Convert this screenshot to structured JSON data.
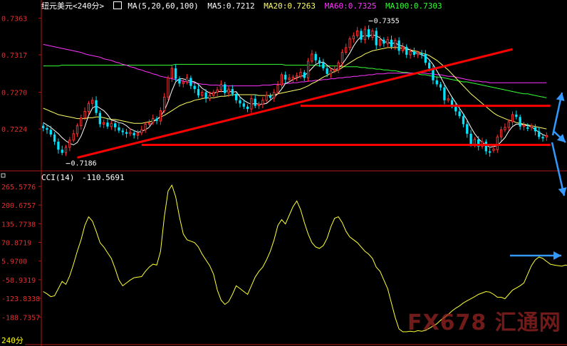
{
  "header": {
    "symbol": "纽元美元<240分>",
    "ma_params": "MA(5,20,60,100)",
    "ma5": "MA5:0.7212",
    "ma20": "MA20:0.7263",
    "ma60": "MA60:0.7325",
    "ma100": "MA100:0.7303"
  },
  "cci_header": {
    "label": "CCI(14)",
    "value": "-110.5691"
  },
  "period_tag": "240分",
  "watermark": "FX678 汇通网",
  "colors": {
    "up": "#ff3030",
    "down": "#00e5ff",
    "ma5": "#ffffff",
    "ma20": "#ffff66",
    "ma60": "#ff33ff",
    "ma100": "#33ff33",
    "cci": "#ffff33",
    "trend": "#ff0000",
    "arrow": "#3399ff",
    "axis": "#b01818"
  },
  "chart_data": [
    {
      "type": "candlestick",
      "ylim": [
        0.7175,
        0.7375
      ],
      "yticks": [
        "0.7363",
        "0.7317",
        "0.7270",
        "0.7224"
      ],
      "annotations": [
        {
          "text": "0.7355",
          "x": 86,
          "y": 0.7355
        },
        {
          "text": "0.7186",
          "x": 6,
          "y": 0.7186
        }
      ],
      "x_count": 134,
      "closes": [
        0.7225,
        0.7223,
        0.7217,
        0.7208,
        0.7198,
        0.7194,
        0.7201,
        0.721,
        0.7218,
        0.7228,
        0.7238,
        0.7246,
        0.7256,
        0.726,
        0.7244,
        0.723,
        0.7232,
        0.7227,
        0.7231,
        0.7226,
        0.7222,
        0.722,
        0.7218,
        0.7219,
        0.7216,
        0.7219,
        0.7223,
        0.723,
        0.7232,
        0.7237,
        0.7234,
        0.7247,
        0.7264,
        0.7288,
        0.73,
        0.7287,
        0.7281,
        0.7283,
        0.7288,
        0.7278,
        0.7274,
        0.7266,
        0.727,
        0.7262,
        0.7266,
        0.727,
        0.7273,
        0.728,
        0.7269,
        0.7274,
        0.7268,
        0.726,
        0.7256,
        0.7252,
        0.7249,
        0.7262,
        0.7253,
        0.7255,
        0.726,
        0.7266,
        0.7263,
        0.727,
        0.7279,
        0.7292,
        0.7286,
        0.7286,
        0.7289,
        0.729,
        0.7295,
        0.7288,
        0.7309,
        0.7318,
        0.731,
        0.7307,
        0.73,
        0.7293,
        0.7297,
        0.7298,
        0.7307,
        0.732,
        0.7326,
        0.7337,
        0.7341,
        0.7347,
        0.7336,
        0.7349,
        0.7339,
        0.7347,
        0.7329,
        0.7336,
        0.7331,
        0.7336,
        0.7327,
        0.7335,
        0.7322,
        0.7327,
        0.7317,
        0.7321,
        0.7317,
        0.7319,
        0.7318,
        0.7307,
        0.73,
        0.7285,
        0.728,
        0.7276,
        0.726,
        0.726,
        0.7254,
        0.7246,
        0.724,
        0.723,
        0.7218,
        0.7205,
        0.7211,
        0.7202,
        0.7208,
        0.7196,
        0.7197,
        0.7198,
        0.7214,
        0.7223,
        0.7226,
        0.7233,
        0.7242,
        0.7239,
        0.7227,
        0.7226,
        0.7226,
        0.7226,
        0.7221,
        0.7214,
        0.7214,
        0.7215
      ],
      "ma5": [
        0.7232,
        0.7229,
        0.7226,
        0.7222,
        0.7218,
        0.7213,
        0.7209,
        0.7206,
        0.7204,
        0.7207,
        0.7215,
        0.7227,
        0.7241,
        0.725,
        0.7253,
        0.725,
        0.7247,
        0.7242,
        0.7235,
        0.7234,
        0.7232,
        0.7231,
        0.7228,
        0.7224,
        0.7222,
        0.722,
        0.7221,
        0.7223,
        0.7226,
        0.7233,
        0.7236,
        0.724,
        0.7247,
        0.7258,
        0.7272,
        0.7283,
        0.7287,
        0.7287,
        0.7285,
        0.7284,
        0.7283,
        0.728,
        0.7275,
        0.7272,
        0.7269,
        0.7268,
        0.7271,
        0.7271,
        0.7271,
        0.7272,
        0.727,
        0.7271,
        0.7264,
        0.726,
        0.7257,
        0.7255,
        0.7256,
        0.7255,
        0.7255,
        0.7256,
        0.726,
        0.7264,
        0.7268,
        0.7274,
        0.7281,
        0.7283,
        0.7286,
        0.7288,
        0.729,
        0.7291,
        0.7295,
        0.73,
        0.7305,
        0.7307,
        0.7308,
        0.7304,
        0.73,
        0.7298,
        0.73,
        0.7305,
        0.7312,
        0.7319,
        0.7328,
        0.7335,
        0.734,
        0.7341,
        0.7341,
        0.7342,
        0.7341,
        0.7338,
        0.7333,
        0.7333,
        0.7331,
        0.7332,
        0.7329,
        0.7328,
        0.7325,
        0.7323,
        0.732,
        0.7319,
        0.7317,
        0.7315,
        0.7311,
        0.7305,
        0.7297,
        0.7289,
        0.728,
        0.7272,
        0.7264,
        0.7257,
        0.725,
        0.7243,
        0.7235,
        0.7226,
        0.7218,
        0.7212,
        0.7207,
        0.7204,
        0.7201,
        0.7202,
        0.7203,
        0.7208,
        0.7213,
        0.7221,
        0.7227,
        0.723,
        0.723,
        0.7229,
        0.7228,
        0.7227,
        0.7223,
        0.722,
        0.7217,
        0.7215
      ],
      "ma20": [
        0.725,
        0.7248,
        0.7246,
        0.7244,
        0.7242,
        0.7241,
        0.724,
        0.7239,
        0.7238,
        0.7237,
        0.7237,
        0.7237,
        0.7238,
        0.7238,
        0.7239,
        0.7239,
        0.7238,
        0.7237,
        0.7236,
        0.7236,
        0.7235,
        0.7234,
        0.7233,
        0.7232,
        0.7231,
        0.7231,
        0.7231,
        0.7232,
        0.7233,
        0.7234,
        0.7236,
        0.7239,
        0.7241,
        0.7244,
        0.7247,
        0.725,
        0.7253,
        0.7255,
        0.7257,
        0.7258,
        0.726,
        0.7261,
        0.7262,
        0.7263,
        0.7263,
        0.7263,
        0.7264,
        0.7265,
        0.7265,
        0.7266,
        0.7267,
        0.7267,
        0.7267,
        0.7267,
        0.7267,
        0.7267,
        0.7267,
        0.7266,
        0.7266,
        0.7266,
        0.7266,
        0.7267,
        0.7268,
        0.7269,
        0.727,
        0.7271,
        0.7272,
        0.7273,
        0.7274,
        0.7276,
        0.7278,
        0.7281,
        0.7283,
        0.7286,
        0.7289,
        0.7291,
        0.7294,
        0.7296,
        0.7298,
        0.7301,
        0.7304,
        0.7307,
        0.731,
        0.7313,
        0.7315,
        0.7318,
        0.732,
        0.7322,
        0.7323,
        0.7324,
        0.7325,
        0.7326,
        0.7326,
        0.7326,
        0.7326,
        0.7325,
        0.7324,
        0.7323,
        0.7322,
        0.7321,
        0.7319,
        0.7318,
        0.7316,
        0.7313,
        0.731,
        0.7306,
        0.7302,
        0.7298,
        0.7293,
        0.7288,
        0.7283,
        0.7278,
        0.7273,
        0.7268,
        0.7264,
        0.726,
        0.7256,
        0.7252,
        0.7248,
        0.7244,
        0.7241,
        0.7239,
        0.7237,
        0.7235,
        0.7234,
        0.7232,
        0.7231,
        0.723,
        0.7229,
        0.7228,
        0.7227,
        0.7226,
        0.7225,
        0.7224
      ],
      "ma60": [
        0.733,
        0.7329,
        0.7328,
        0.7327,
        0.7326,
        0.7325,
        0.7324,
        0.7323,
        0.7322,
        0.7321,
        0.732,
        0.7318,
        0.7317,
        0.7316,
        0.7315,
        0.7314,
        0.7312,
        0.7311,
        0.731,
        0.7308,
        0.7307,
        0.7305,
        0.7304,
        0.7302,
        0.7301,
        0.7299,
        0.7298,
        0.7296,
        0.7295,
        0.7293,
        0.7292,
        0.729,
        0.7289,
        0.7288,
        0.7287,
        0.7286,
        0.7285,
        0.7284,
        0.7283,
        0.7282,
        0.7282,
        0.7281,
        0.728,
        0.728,
        0.7279,
        0.7279,
        0.7279,
        0.7278,
        0.7278,
        0.7278,
        0.7278,
        0.7278,
        0.7278,
        0.7278,
        0.7278,
        0.7278,
        0.7278,
        0.7278,
        0.7279,
        0.7279,
        0.7279,
        0.728,
        0.728,
        0.728,
        0.7281,
        0.7281,
        0.7282,
        0.7282,
        0.7283,
        0.7283,
        0.7284,
        0.7284,
        0.7285,
        0.7285,
        0.7286,
        0.7286,
        0.7287,
        0.7287,
        0.7288,
        0.7288,
        0.7289,
        0.7289,
        0.729,
        0.729,
        0.7291,
        0.7291,
        0.7292,
        0.7292,
        0.7293,
        0.7293,
        0.7293,
        0.7294,
        0.7294,
        0.7294,
        0.7294,
        0.7294,
        0.7294,
        0.7294,
        0.7294,
        0.7294,
        0.7294,
        0.7294,
        0.7293,
        0.7293,
        0.7292,
        0.7292,
        0.7291,
        0.729,
        0.729,
        0.7289,
        0.7288,
        0.7287,
        0.7286,
        0.7285,
        0.7284,
        0.7284,
        0.7283,
        0.7283,
        0.7282,
        0.7282,
        0.7282,
        0.7282,
        0.7282,
        0.7282,
        0.7282,
        0.7282,
        0.7282,
        0.7282,
        0.7282,
        0.7282,
        0.7282,
        0.7282,
        0.7282,
        0.7282
      ],
      "ma100": [
        0.7303,
        0.7303,
        0.7303,
        0.7303,
        0.7303,
        0.7304,
        0.7304,
        0.7304,
        0.7304,
        0.7304,
        0.7304,
        0.7304,
        0.7304,
        0.7304,
        0.7304,
        0.7304,
        0.7304,
        0.7304,
        0.7304,
        0.7304,
        0.7304,
        0.7304,
        0.7304,
        0.7304,
        0.7304,
        0.7304,
        0.7304,
        0.7304,
        0.7304,
        0.7304,
        0.7304,
        0.7304,
        0.7304,
        0.7304,
        0.7304,
        0.7305,
        0.7305,
        0.7305,
        0.7305,
        0.7305,
        0.7305,
        0.7305,
        0.7305,
        0.7305,
        0.7305,
        0.7305,
        0.7305,
        0.7305,
        0.7305,
        0.7305,
        0.7305,
        0.7305,
        0.7305,
        0.7305,
        0.7305,
        0.7305,
        0.7305,
        0.7305,
        0.7305,
        0.7305,
        0.7305,
        0.7305,
        0.7305,
        0.7305,
        0.7304,
        0.7304,
        0.7304,
        0.7304,
        0.7304,
        0.7304,
        0.7304,
        0.7304,
        0.7304,
        0.7303,
        0.7303,
        0.7303,
        0.7303,
        0.7303,
        0.7303,
        0.7302,
        0.7302,
        0.7302,
        0.7302,
        0.7302,
        0.7301,
        0.7301,
        0.73,
        0.73,
        0.7299,
        0.7299,
        0.7298,
        0.7298,
        0.7297,
        0.7297,
        0.7296,
        0.7295,
        0.7295,
        0.7294,
        0.7294,
        0.7293,
        0.7292,
        0.7292,
        0.7291,
        0.729,
        0.7289,
        0.7289,
        0.7288,
        0.7287,
        0.7286,
        0.7285,
        0.7284,
        0.7283,
        0.7283,
        0.7282,
        0.7281,
        0.728,
        0.7279,
        0.7278,
        0.7277,
        0.7276,
        0.7275,
        0.7274,
        0.7273,
        0.7272,
        0.7271,
        0.727,
        0.7269,
        0.7268,
        0.7268,
        0.7267,
        0.7266,
        0.7265,
        0.7264,
        0.7263
      ],
      "trendlines": [
        {
          "x1": 9,
          "y1": 0.7188,
          "x2": 124,
          "y2": 0.7324
        },
        {
          "x1": 68,
          "y1": 0.7253,
          "x2": 134,
          "y2": 0.7253
        },
        {
          "x1": 26,
          "y1": 0.7204,
          "x2": 134,
          "y2": 0.7204
        }
      ]
    },
    {
      "type": "line",
      "name": "CCI(14)",
      "ylim": [
        -240,
        290
      ],
      "yticks": [
        "265.5776",
        "200.6757",
        "135.7738",
        "70.8719",
        "5.9700",
        "-58.9319",
        "-123.8338",
        "-188.7357"
      ],
      "values": [
        -100,
        -108,
        -118,
        -115,
        -90,
        -65,
        -75,
        -45,
        -5,
        40,
        80,
        130,
        160,
        145,
        110,
        70,
        55,
        35,
        15,
        -20,
        -60,
        -80,
        -70,
        -60,
        -52,
        -50,
        -48,
        -30,
        -15,
        -5,
        -8,
        40,
        160,
        250,
        270,
        230,
        160,
        100,
        80,
        75,
        70,
        55,
        30,
        10,
        -10,
        -40,
        -95,
        -130,
        -145,
        -135,
        -110,
        -80,
        -90,
        -100,
        -110,
        -80,
        -50,
        -30,
        -15,
        10,
        40,
        80,
        130,
        150,
        135,
        165,
        195,
        215,
        185,
        140,
        100,
        70,
        55,
        50,
        60,
        85,
        125,
        155,
        160,
        140,
        110,
        90,
        80,
        70,
        55,
        40,
        30,
        15,
        -15,
        -30,
        -60,
        -90,
        -140,
        -190,
        -230,
        -240,
        -240,
        -238,
        -240,
        -236,
        -238,
        -235,
        -228,
        -220,
        -212,
        -200,
        -190,
        -180,
        -168,
        -158,
        -150,
        -140,
        -132,
        -125,
        -118,
        -110,
        -105,
        -100,
        -102,
        -110,
        -120,
        -120,
        -125,
        -110,
        -95,
        -88,
        -80,
        -70,
        -40,
        -10,
        10,
        20,
        15,
        5,
        -5,
        -8,
        -10,
        -12,
        -8,
        -11
      ]
    }
  ]
}
